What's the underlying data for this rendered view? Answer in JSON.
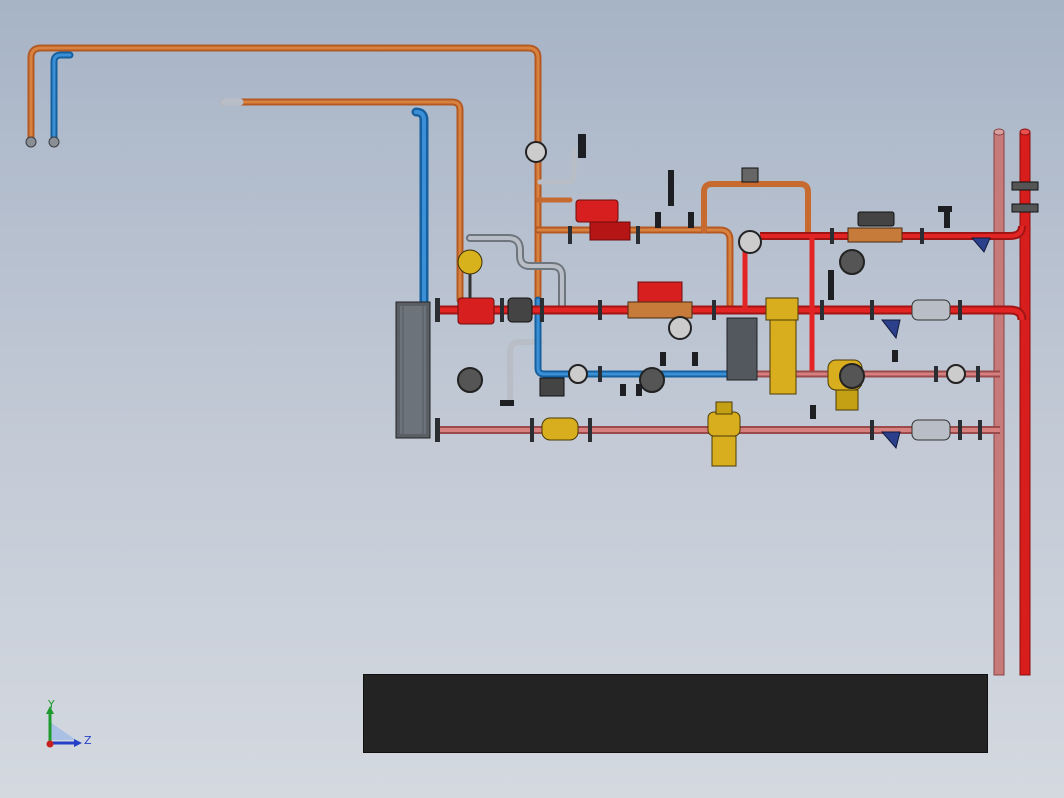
{
  "viewport": {
    "background_top": "#a7b4c6",
    "background_bottom": "#d4d9e0"
  },
  "pipes": {
    "hot_color": "#d31f1f",
    "return_color": "#cf6b6b",
    "supply_orange_color": "#c66a30",
    "cold_color": "#1e6fb8",
    "grey_color": "#9aa1aa"
  },
  "axis_triad": {
    "y_label": "Y",
    "z_label": "Z",
    "y_color": "#1d9a2e",
    "z_color": "#2540c8",
    "x_color": "#c81e1e"
  },
  "info_panel": {
    "color": "#232323"
  },
  "components": [
    {
      "name": "heat-exchanger"
    },
    {
      "name": "circulation-pump"
    },
    {
      "name": "heat-meter"
    },
    {
      "name": "three-way-valve"
    },
    {
      "name": "pressure-gauge"
    },
    {
      "name": "strainer"
    },
    {
      "name": "ball-valve"
    }
  ]
}
